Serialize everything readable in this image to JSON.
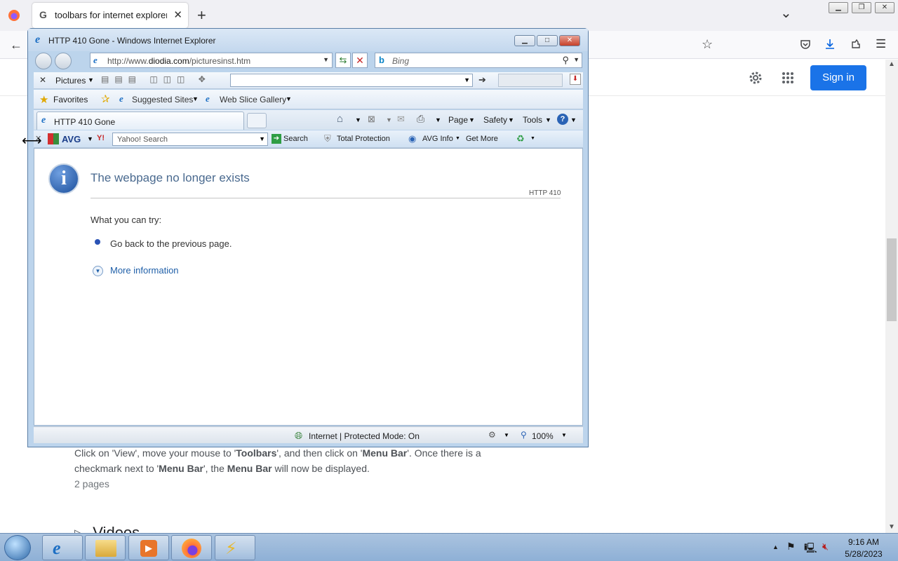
{
  "firefox": {
    "tab_title": "toolbars for internet explorer - Google",
    "new_tab": "+",
    "tab_close": "✕",
    "list_all_tabs": "⌄"
  },
  "google": {
    "sign_in": "Sign in",
    "result_line1_parts": [
      "Click on 'View', move your mouse to '",
      "Toolbars",
      "', and then click on '",
      "Menu Bar",
      "'. Once there is a"
    ],
    "result_line2_parts": [
      "checkmark next to '",
      "Menu Bar",
      "', the ",
      "Menu Bar",
      " will now be displayed."
    ],
    "result_pages": "2 pages",
    "videos_heading": "Videos"
  },
  "ie": {
    "window_title": "HTTP 410 Gone - Windows Internet Explorer",
    "address_prefix": "http://www.",
    "address_domain": "diodia.com",
    "address_path": "/picturesinst.htm",
    "search_placeholder": "Bing",
    "pictures_label": "Pictures",
    "favorites_label": "Favorites",
    "suggested_sites": "Suggested Sites",
    "web_slice_gallery": "Web Slice Gallery",
    "tab_title": "HTTP 410 Gone",
    "cmd_page": "Page",
    "cmd_safety": "Safety",
    "cmd_tools": "Tools",
    "avg_label": "AVG",
    "yahoo_search_placeholder": "Yahoo! Search",
    "search_button": "Search",
    "total_protection": "Total Protection",
    "avg_info": "AVG Info",
    "get_more": "Get More",
    "error_heading": "The webpage no longer exists",
    "error_code": "HTTP 410",
    "what_you_can_try": "What you can try:",
    "go_back": "Go back to the previous page.",
    "more_information": "More information",
    "status_zone": "Internet | Protected Mode: On",
    "zoom": "100%"
  },
  "taskbar": {
    "time": "9:16 AM",
    "date": "5/28/2023"
  },
  "colors": {
    "google_blue": "#1a73e8",
    "ie_link_blue": "#1f5fa8",
    "ie_heading": "#4a6a8f",
    "taskbar": "#9cbadc"
  }
}
